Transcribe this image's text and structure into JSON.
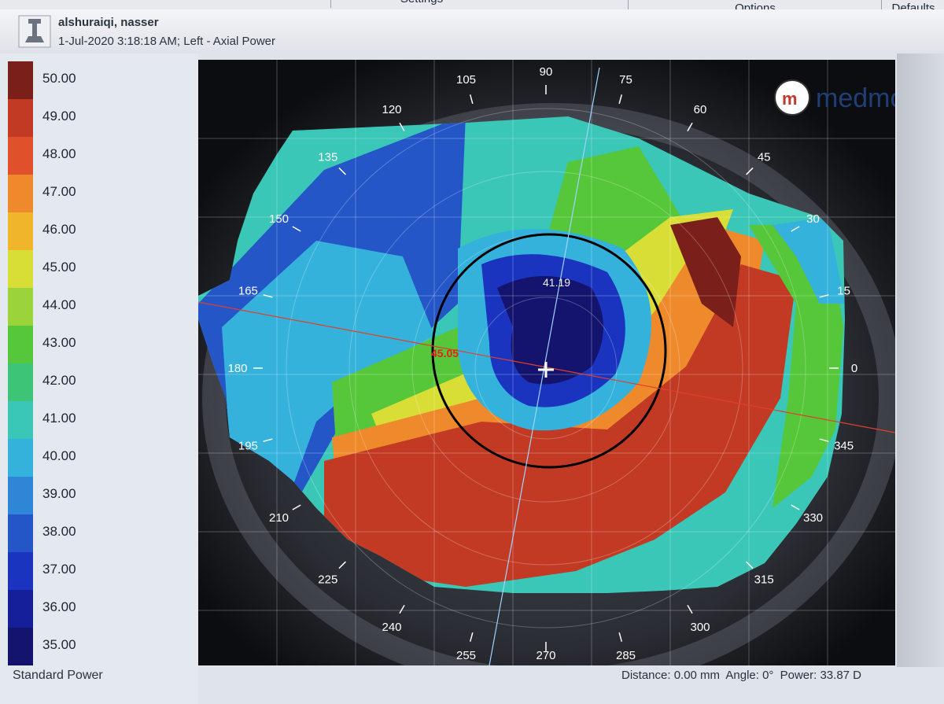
{
  "menu": {
    "settings_label": "Settings",
    "options_label": "Options",
    "defaults_label": "Defaults"
  },
  "header": {
    "patient_name": "alshuraiqi, nasser",
    "exam_info": "1-Jul-2020 3:18:18 AM; Left - Axial Power"
  },
  "scale": {
    "title": "Standard Power",
    "entries": [
      {
        "label": "50.00",
        "color": "#7a1f1a"
      },
      {
        "label": "49.00",
        "color": "#c23a24"
      },
      {
        "label": "48.00",
        "color": "#e0502a"
      },
      {
        "label": "47.00",
        "color": "#ee8a2c"
      },
      {
        "label": "46.00",
        "color": "#f1b52c"
      },
      {
        "label": "45.00",
        "color": "#d9de37"
      },
      {
        "label": "44.00",
        "color": "#9ad43a"
      },
      {
        "label": "43.00",
        "color": "#56c63a"
      },
      {
        "label": "42.00",
        "color": "#3ec476"
      },
      {
        "label": "41.00",
        "color": "#3ac7b8"
      },
      {
        "label": "40.00",
        "color": "#35b2dc"
      },
      {
        "label": "39.00",
        "color": "#2f86d6"
      },
      {
        "label": "38.00",
        "color": "#2456c8"
      },
      {
        "label": "37.00",
        "color": "#1a34c0"
      },
      {
        "label": "36.00",
        "color": "#151f9a"
      },
      {
        "label": "35.00",
        "color": "#14146e"
      }
    ]
  },
  "map": {
    "brand": "medmont",
    "center_value": "41.19",
    "side_value": "45.05",
    "angles": [
      "0",
      "15",
      "30",
      "45",
      "60",
      "75",
      "90",
      "105",
      "120",
      "135",
      "150",
      "165",
      "180",
      "195",
      "210",
      "225",
      "240",
      "255",
      "270",
      "285",
      "300",
      "315",
      "330",
      "345"
    ]
  },
  "status": {
    "distance": "Distance: 0.00 mm",
    "angle": "Angle: 0°",
    "power": "Power: 33.87 D"
  }
}
